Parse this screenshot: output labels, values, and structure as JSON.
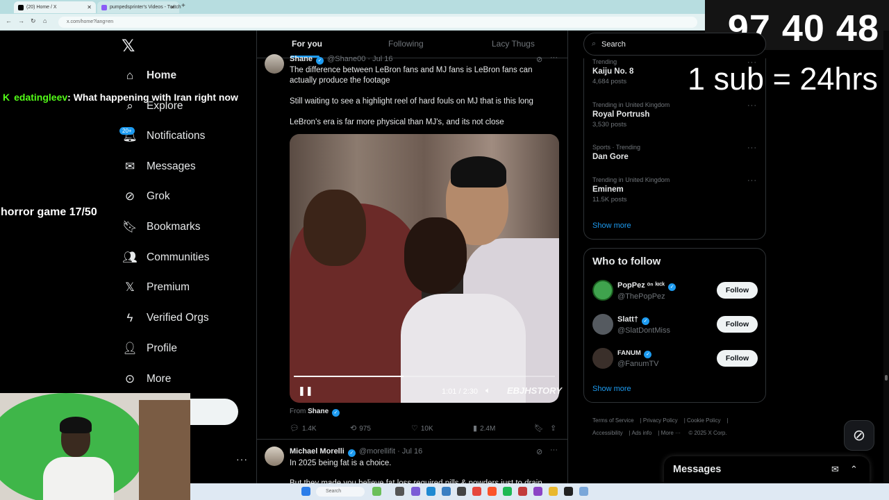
{
  "browser": {
    "tabs": [
      {
        "label": "(20) Home / X"
      },
      {
        "label": "pumpedsprinter's Videos - Twitch"
      }
    ],
    "url": "x.com/home?lang=en"
  },
  "sidebar": {
    "items": [
      {
        "label": "Home",
        "icon": "home-icon"
      },
      {
        "label": "Explore",
        "icon": "search-icon"
      },
      {
        "label": "Notifications",
        "icon": "bell-icon"
      },
      {
        "label": "Messages",
        "icon": "mail-icon"
      },
      {
        "label": "Grok",
        "icon": "grok-icon"
      },
      {
        "label": "Bookmarks",
        "icon": "bookmark-icon"
      },
      {
        "label": "Communities",
        "icon": "people-icon"
      },
      {
        "label": "Premium",
        "icon": "x-icon"
      },
      {
        "label": "Verified Orgs",
        "icon": "lightning-icon"
      },
      {
        "label": "Profile",
        "icon": "person-icon"
      },
      {
        "label": "More",
        "icon": "more-circle-icon"
      }
    ],
    "notif_badge": "20+"
  },
  "overlay": {
    "chat_user": "edatingleev",
    "chat_message": ": What happening with Iran right now",
    "horror_goal": "horror game 17/50",
    "timer": "97 40 48",
    "sub_rule": "1 sub = 24hrs"
  },
  "feed": {
    "tabs": [
      "For you",
      "Following",
      "Lacy Thugs"
    ],
    "post1": {
      "name": "Shane",
      "handle": "@Shane00",
      "date": "· Jul 16",
      "text1": "The difference between LeBron fans and MJ fans is LeBron fans can actually produce the footage",
      "text2": "Still waiting to see a highlight reel of hard fouls on MJ that is this long",
      "text3": "LeBron's era is far more physical than MJ's, and its not close",
      "video_time": "1:01 / 2:30",
      "video_progress": 0.42,
      "video_watermark": "EBJHSTORY",
      "from_label": "From",
      "from_name": "Shane",
      "replies": "1.4K",
      "reposts": "975",
      "likes": "10K",
      "views": "2.4M"
    },
    "post2": {
      "name": "Michael Morelli",
      "handle": "@morellifit",
      "date": "· Jul 16",
      "text1": "In 2025 being fat is a choice.",
      "text2": "But they made you believe fat loss required pills & powders just to drain"
    }
  },
  "right": {
    "search_placeholder": "Search",
    "trends": [
      {
        "context": "Trending",
        "title": "Kaiju No. 8",
        "count": "4,684 posts"
      },
      {
        "context": "Trending in United Kingdom",
        "title": "Royal Portrush",
        "count": "3,530 posts"
      },
      {
        "context": "Sports · Trending",
        "title": "Dan Gore",
        "count": ""
      },
      {
        "context": "Trending in United Kingdom",
        "title": "Eminem",
        "count": "11.5K posts"
      }
    ],
    "show_more": "Show more",
    "who_to_follow": "Who to follow",
    "follows": [
      {
        "name": "PopPez ᵒⁿ ᵏᶦᶜᵏ",
        "handle": "@ThePopPez"
      },
      {
        "name": "Slatt†",
        "handle": "@SlatDontMiss"
      },
      {
        "name": "FANUM",
        "handle": "@FanumTV"
      }
    ],
    "follow_label": "Follow",
    "footer": [
      "Terms of Service",
      "Privacy Policy",
      "Cookie Policy",
      "Accessibility",
      "Ads info",
      "More ···",
      "© 2025 X Corp."
    ],
    "messages_title": "Messages"
  },
  "taskbar": {
    "search_placeholder": "Search"
  }
}
